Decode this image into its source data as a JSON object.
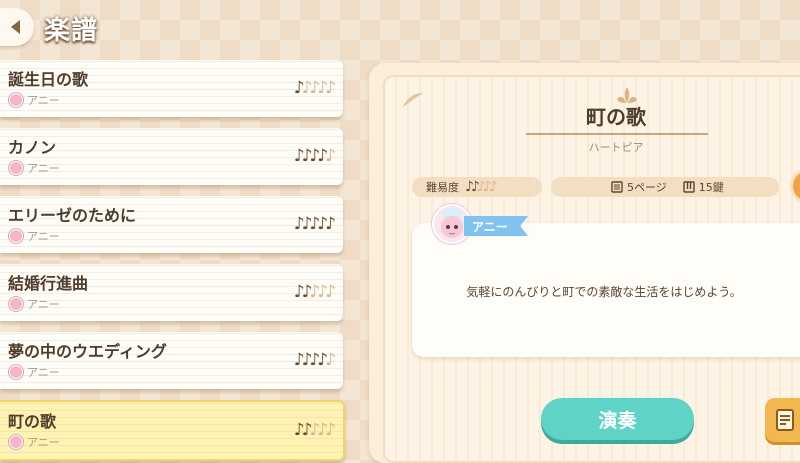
{
  "header": {
    "title": "楽譜"
  },
  "songs": [
    {
      "title": "誕生日の歌",
      "composer": "アニー",
      "difficulty": 1
    },
    {
      "title": "カノン",
      "composer": "アニー",
      "difficulty": 4
    },
    {
      "title": "エリーゼのために",
      "composer": "アニー",
      "difficulty": 5
    },
    {
      "title": "結婚行進曲",
      "composer": "アニー",
      "difficulty": 2
    },
    {
      "title": "夢の中のウエディング",
      "composer": "アニー",
      "difficulty": 4
    },
    {
      "title": "町の歌",
      "composer": "アニー",
      "difficulty": 2,
      "selected": true
    }
  ],
  "detail": {
    "title": "町の歌",
    "subtitle": "ハートピア",
    "difficulty_label": "難易度",
    "difficulty": 2,
    "pages": "5ページ",
    "keys": "15鍵",
    "speaker": "アニー",
    "message": "気軽にのんびりと町での素敵な生活をはじめよう。"
  },
  "actions": {
    "play_label": "演奏"
  },
  "colors": {
    "accent_teal": "#5fd3c6",
    "note_on": "#6b4a2c",
    "note_off": "#d8b58c",
    "selected_card": "#fff2b5",
    "speaker_tag": "#7fc3ee"
  }
}
